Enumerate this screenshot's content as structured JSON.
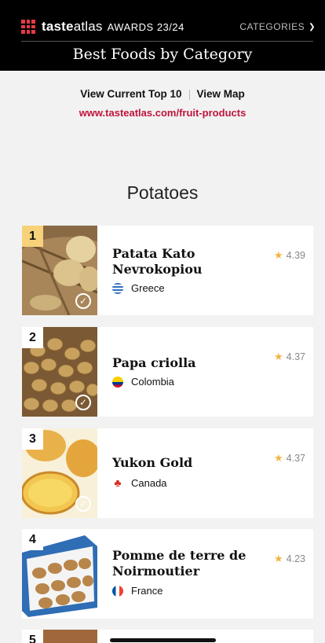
{
  "header": {
    "brand_part1": "taste",
    "brand_part2": "atlas",
    "awards": "AWARDS 23/24",
    "categories_label": "CATEGORIES",
    "page_title": "Best Foods by Category"
  },
  "links": {
    "top10": "View Current Top 10",
    "map": "View Map",
    "url": "www.tasteatlas.com/fruit-products"
  },
  "section_title": "Potatoes",
  "items": [
    {
      "rank": "1",
      "name": "Patata Kato Nevrokopiou",
      "country": "Greece",
      "rating": "4.39"
    },
    {
      "rank": "2",
      "name": "Papa criolla",
      "country": "Colombia",
      "rating": "4.37"
    },
    {
      "rank": "3",
      "name": "Yukon Gold",
      "country": "Canada",
      "rating": "4.37"
    },
    {
      "rank": "4",
      "name": "Pomme de terre de Noirmoutier",
      "country": "France",
      "rating": "4.23"
    },
    {
      "rank": "5"
    }
  ],
  "colors": {
    "accent": "#c0143c",
    "rank_highlight": "#f7d27a",
    "star": "#f3b53f"
  }
}
